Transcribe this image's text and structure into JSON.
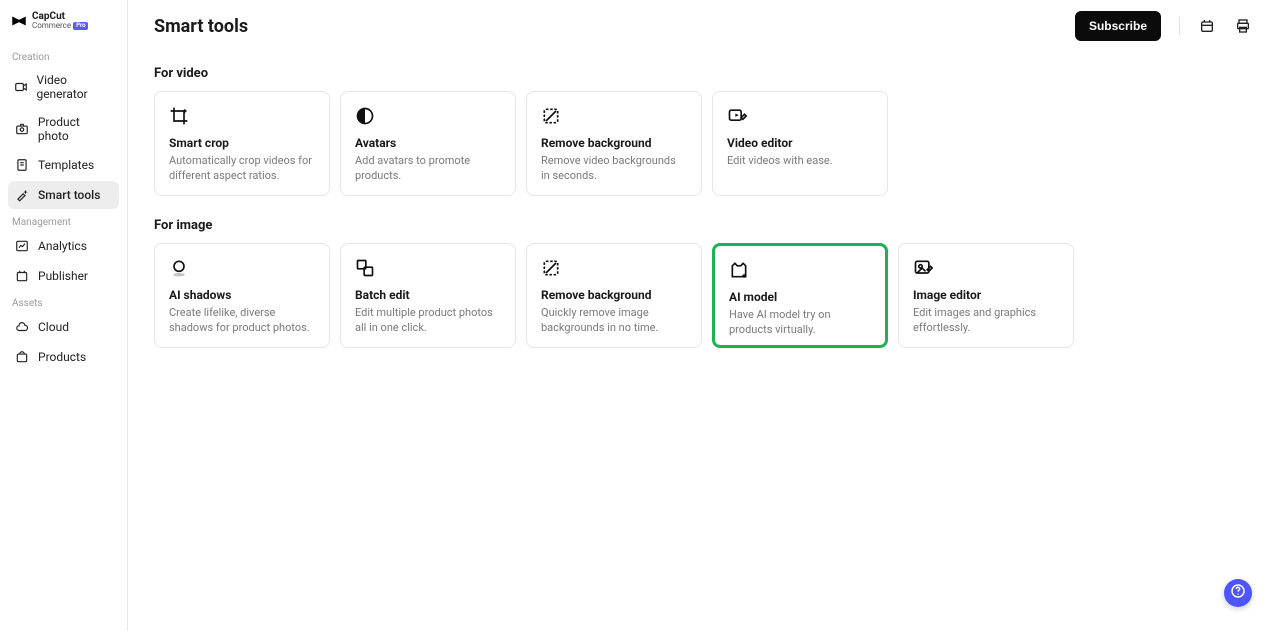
{
  "app": {
    "logo_main": "CapCut",
    "logo_sub": "Commerce",
    "logo_badge": "Pro"
  },
  "sidebar": {
    "sections": [
      {
        "label": "Creation",
        "items": [
          {
            "label": "Video generator"
          },
          {
            "label": "Product photo"
          },
          {
            "label": "Templates"
          },
          {
            "label": "Smart tools",
            "active": true
          }
        ]
      },
      {
        "label": "Management",
        "items": [
          {
            "label": "Analytics"
          },
          {
            "label": "Publisher"
          }
        ]
      },
      {
        "label": "Assets",
        "items": [
          {
            "label": "Cloud"
          },
          {
            "label": "Products"
          }
        ]
      }
    ]
  },
  "header": {
    "title": "Smart tools",
    "subscribe_label": "Subscribe"
  },
  "groups": [
    {
      "title": "For video",
      "cards": [
        {
          "title": "Smart crop",
          "desc": "Automatically crop videos for different aspect ratios."
        },
        {
          "title": "Avatars",
          "desc": "Add avatars to promote products."
        },
        {
          "title": "Remove background",
          "desc": "Remove video backgrounds in seconds."
        },
        {
          "title": "Video editor",
          "desc": "Edit videos with ease."
        }
      ]
    },
    {
      "title": "For image",
      "cards": [
        {
          "title": "AI shadows",
          "desc": "Create lifelike, diverse shadows for product photos."
        },
        {
          "title": "Batch edit",
          "desc": "Edit multiple product photos all in one click."
        },
        {
          "title": "Remove background",
          "desc": "Quickly remove image backgrounds in no time."
        },
        {
          "title": "AI model",
          "desc": "Have AI model try on products virtually.",
          "highlight": true
        },
        {
          "title": "Image editor",
          "desc": "Edit images and graphics effortlessly."
        }
      ]
    }
  ]
}
